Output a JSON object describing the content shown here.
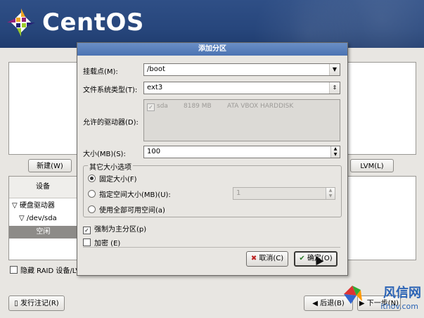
{
  "brand": {
    "name": "CentOS"
  },
  "background": {
    "new_button": "新建(W)",
    "lvm_button": "LVM(L)",
    "table_header_device": "设备",
    "tree_group": "硬盘驱动器",
    "tree_device": "/dev/sda",
    "tree_free": "空闲",
    "hide_raid_label": "隐藏 RAID 设备/LV",
    "release_notes_button": "发行注记(R)",
    "back_button": "后退(B)",
    "next_button": "下一步(N)"
  },
  "dialog": {
    "title": "添加分区",
    "mount_point_label": "挂载点(M):",
    "mount_point_value": "/boot",
    "fs_type_label": "文件系统类型(T):",
    "fs_type_value": "ext3",
    "drives_label": "允许的驱动器(D):",
    "drive": {
      "name": "sda",
      "size": "8189 MB",
      "model": "ATA VBOX HARDDISK"
    },
    "size_label": "大小(MB)(S):",
    "size_value": "100",
    "other_size_legend": "其它大小选项",
    "opt_fixed": "固定大小(F)",
    "opt_fill_to": "指定空间大小(MB)(U):",
    "opt_fill_to_value": "1",
    "opt_fill_all": "使用全部可用空间(a)",
    "force_primary": "强制为主分区(p)",
    "encrypt": "加密 (E)",
    "cancel_button": "取消(C)",
    "ok_button": "确定(O)"
  },
  "watermark": {
    "text": "风信网",
    "url": "ithov.com"
  },
  "colors": {
    "banner": "#27467c",
    "title_bar": "#5a82bd",
    "selected_row": "#8d8b88"
  }
}
